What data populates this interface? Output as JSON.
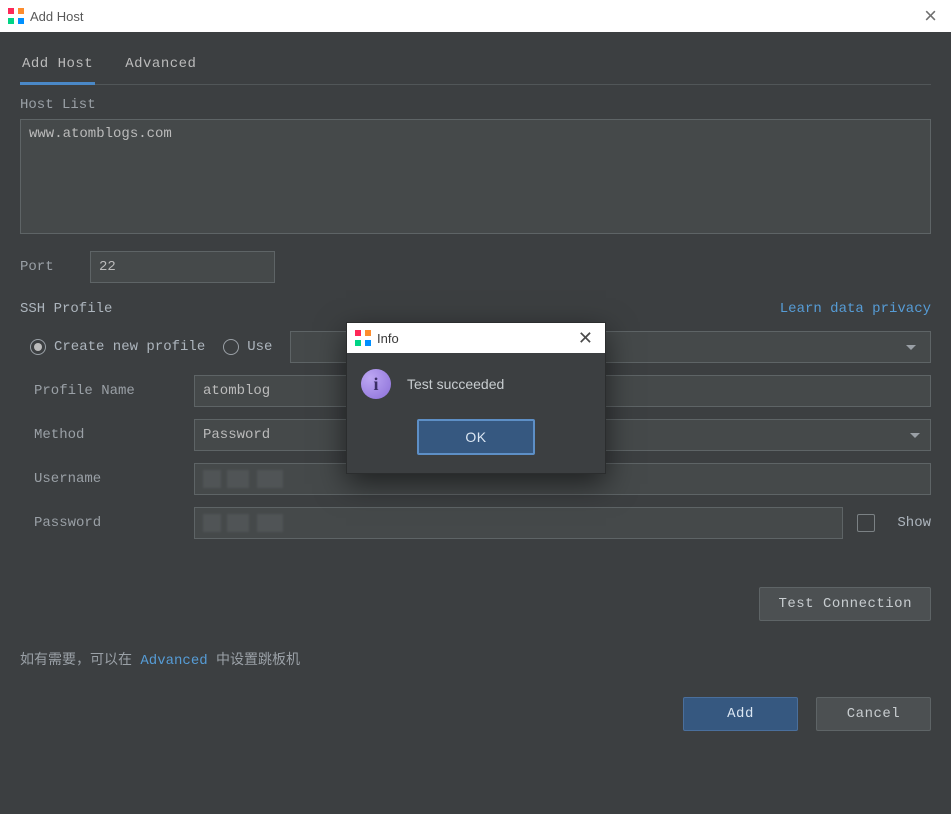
{
  "window": {
    "title": "Add Host"
  },
  "tabs": {
    "add_host": "Add Host",
    "advanced": "Advanced"
  },
  "labels": {
    "host_list": "Host List",
    "port": "Port",
    "ssh_profile": "SSH Profile",
    "learn_privacy": "Learn data privacy",
    "create_new": "Create new profile",
    "use_existing": "Use",
    "profile_name": "Profile Name",
    "method": "Method",
    "username": "Username",
    "password": "Password",
    "show": "Show",
    "test_connection": "Test Connection",
    "hint_prefix": "如有需要，可以在 ",
    "hint_link": "Advanced",
    "hint_suffix": " 中设置跳板机",
    "add": "Add",
    "cancel": "Cancel"
  },
  "values": {
    "host_list": "www.atomblogs.com",
    "port": "22",
    "profile_name": "atomblog",
    "method": "Password"
  },
  "modal": {
    "title": "Info",
    "message": "Test succeeded",
    "ok": "OK"
  }
}
